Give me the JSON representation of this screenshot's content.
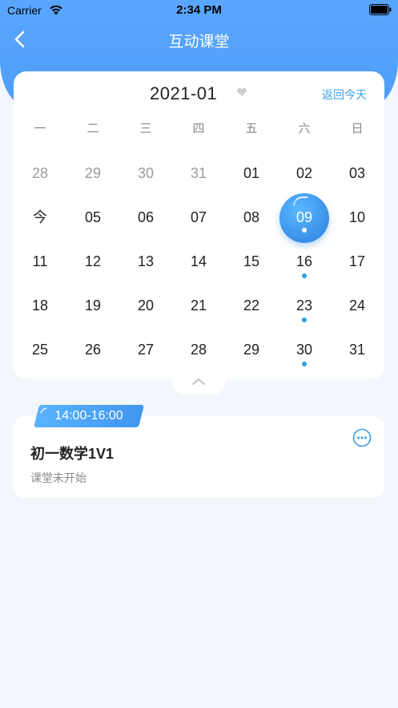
{
  "status_bar": {
    "carrier": "Carrier",
    "time": "2:34 PM"
  },
  "nav": {
    "title": "互动课堂",
    "back_icon": "chevron-left-icon"
  },
  "calendar": {
    "month": "2021-01",
    "back_today": "返回今天",
    "weekdays": [
      "一",
      "二",
      "三",
      "四",
      "五",
      "六",
      "日"
    ],
    "weeks": [
      [
        {
          "label": "28",
          "muted": true
        },
        {
          "label": "29",
          "muted": true
        },
        {
          "label": "30",
          "muted": true
        },
        {
          "label": "31",
          "muted": true
        },
        {
          "label": "01"
        },
        {
          "label": "02"
        },
        {
          "label": "03"
        }
      ],
      [
        {
          "label": "今"
        },
        {
          "label": "05"
        },
        {
          "label": "06"
        },
        {
          "label": "07"
        },
        {
          "label": "08"
        },
        {
          "label": "09",
          "selected": true,
          "dot": true
        },
        {
          "label": "10"
        }
      ],
      [
        {
          "label": "11"
        },
        {
          "label": "12"
        },
        {
          "label": "13"
        },
        {
          "label": "14"
        },
        {
          "label": "15"
        },
        {
          "label": "16",
          "dot": true
        },
        {
          "label": "17"
        }
      ],
      [
        {
          "label": "18"
        },
        {
          "label": "19"
        },
        {
          "label": "20"
        },
        {
          "label": "21"
        },
        {
          "label": "22"
        },
        {
          "label": "23",
          "dot": true
        },
        {
          "label": "24"
        }
      ],
      [
        {
          "label": "25"
        },
        {
          "label": "26"
        },
        {
          "label": "27"
        },
        {
          "label": "28"
        },
        {
          "label": "29"
        },
        {
          "label": "30",
          "dot": true
        },
        {
          "label": "31"
        }
      ]
    ],
    "accent_color": "#3a8fe8",
    "dot_color": "#2a9ee6"
  },
  "event": {
    "time": "14:00-16:00",
    "title": "初一数学1V1",
    "status": "课堂未开始",
    "more_icon": "more-circle-icon"
  },
  "colors": {
    "header": "#4d9ef9",
    "background": "#f3f7fd",
    "link": "#3aa0e6"
  }
}
